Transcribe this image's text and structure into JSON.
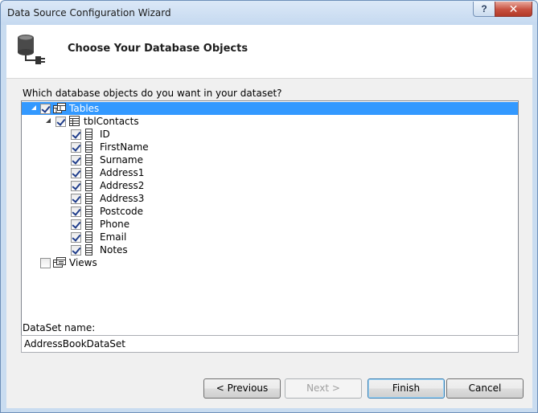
{
  "window": {
    "title": "Data Source Configuration Wizard",
    "help_glyph": "?",
    "close_glyph": "✕"
  },
  "header": {
    "title": "Choose Your Database Objects",
    "icon": "database-connect-icon"
  },
  "prompt": "Which database objects do you want in your dataset?",
  "tree": {
    "tables": {
      "label": "Tables",
      "checked": true,
      "expanded": true,
      "selected": true
    },
    "table": {
      "label": "tblContacts",
      "checked": true,
      "expanded": true
    },
    "columns": [
      {
        "label": "ID",
        "checked": true
      },
      {
        "label": "FirstName",
        "checked": true
      },
      {
        "label": "Surname",
        "checked": true
      },
      {
        "label": "Address1",
        "checked": true
      },
      {
        "label": "Address2",
        "checked": true
      },
      {
        "label": "Address3",
        "checked": true
      },
      {
        "label": "Postcode",
        "checked": true
      },
      {
        "label": "Phone",
        "checked": true
      },
      {
        "label": "Email",
        "checked": true
      },
      {
        "label": "Notes",
        "checked": true
      }
    ],
    "views": {
      "label": "Views",
      "checked": false,
      "expanded": false
    }
  },
  "dataset": {
    "label": "DataSet name:",
    "value": "AddressBookDataSet"
  },
  "buttons": {
    "previous": "< Previous",
    "next": "Next >",
    "finish": "Finish",
    "cancel": "Cancel"
  },
  "colors": {
    "selection": "#3399ff",
    "window_frame": "#c9dcf0",
    "close_button": "#c7503f"
  }
}
